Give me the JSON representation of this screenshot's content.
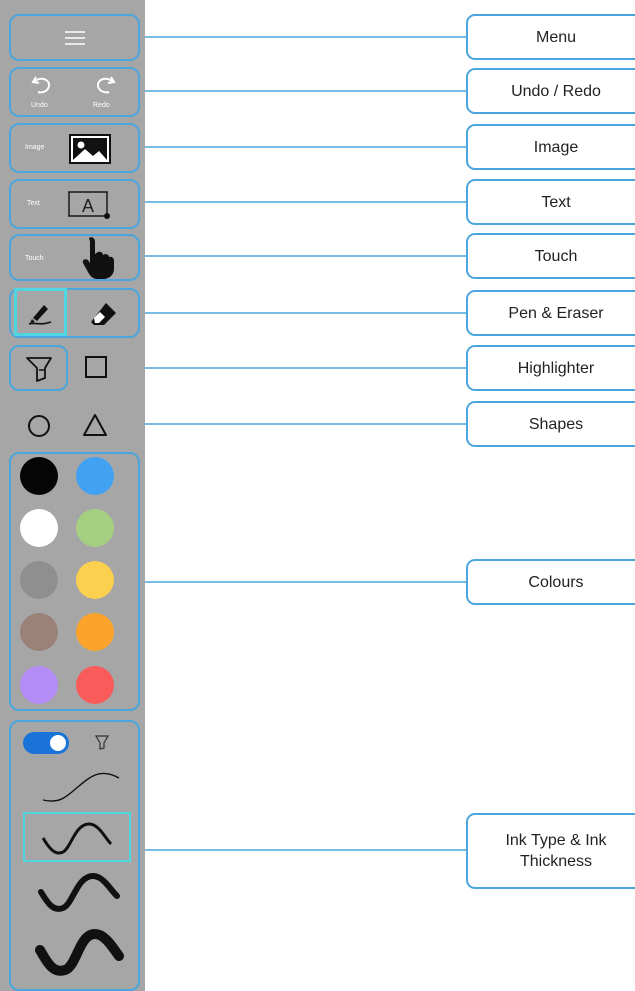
{
  "colors": {
    "sidebar_bg": "#a6a6a6",
    "accent": "#4aa6dc",
    "selected_highlight": "#4fd6e0",
    "toggle_on": "#1a73d9"
  },
  "toolbar": {
    "menu_icon": "hamburger-icon",
    "undo_label": "Undo",
    "redo_label": "Redo",
    "image_label": "Image",
    "text_label": "Text",
    "touch_label": "Touch",
    "pen_icon": "pen-icon",
    "eraser_icon": "eraser-icon",
    "highlighter_icon": "highlighter-icon",
    "rectangle_icon": "rectangle-icon",
    "circle_icon": "circle-icon",
    "triangle_icon": "triangle-icon",
    "colours": [
      {
        "name": "black",
        "hex": "#050505"
      },
      {
        "name": "blue",
        "hex": "#41a2f3"
      },
      {
        "name": "white",
        "hex": "#ffffff"
      },
      {
        "name": "green",
        "hex": "#a5cf81"
      },
      {
        "name": "grey",
        "hex": "#8f8f8f"
      },
      {
        "name": "yellow",
        "hex": "#fbd04e"
      },
      {
        "name": "brown",
        "hex": "#9a8278"
      },
      {
        "name": "orange",
        "hex": "#fca32c"
      },
      {
        "name": "purple",
        "hex": "#b38cf6"
      },
      {
        "name": "red",
        "hex": "#f95a5a"
      }
    ],
    "ink_toggle_on": true,
    "ink_toggle_icon": "pencil-tip-icon",
    "ink_thickness_options": [
      "thin",
      "medium",
      "thick",
      "extra-thick"
    ],
    "ink_thickness_selected": "medium"
  },
  "callouts": {
    "menu": "Menu",
    "undo_redo": "Undo / Redo",
    "image": "Image",
    "text": "Text",
    "touch": "Touch",
    "pen_eraser": "Pen & Eraser",
    "highlighter": "Highlighter",
    "shapes": "Shapes",
    "colours": "Colours",
    "ink": "Ink Type & Ink Thickness"
  }
}
